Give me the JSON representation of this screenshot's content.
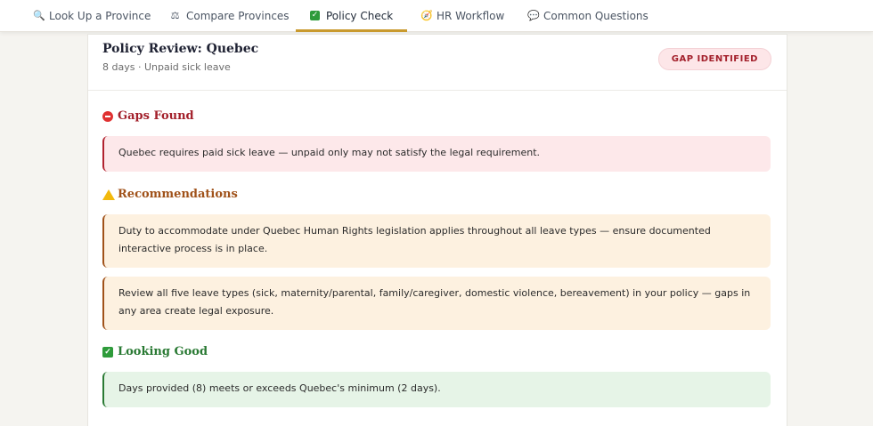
{
  "nav": {
    "tabs": [
      {
        "icon": "search-icon",
        "label": "Look Up a Province"
      },
      {
        "icon": "scales-icon",
        "label": "Compare Provinces"
      },
      {
        "icon": "check-icon",
        "label": "Policy Check",
        "active": true
      },
      {
        "icon": "compass-icon",
        "label": "HR Workflow"
      },
      {
        "icon": "speech-bubble-icon",
        "label": "Common Questions"
      }
    ]
  },
  "review": {
    "title": "Policy Review: Quebec",
    "subtitle": "8 days · Unpaid sick leave",
    "badge": "GAP IDENTIFIED"
  },
  "sections": {
    "gaps": {
      "heading": "Gaps Found",
      "items": [
        "Quebec requires paid sick leave — unpaid only may not satisfy the legal requirement."
      ]
    },
    "recommendations": {
      "heading": "Recommendations",
      "items": [
        "Duty to accommodate under Quebec Human Rights legislation applies throughout all leave types — ensure documented interactive process is in place.",
        "Review all five leave types (sick, maternity/parental, family/caregiver, domestic violence, bereavement) in your policy — gaps in any area create legal exposure."
      ]
    },
    "good": {
      "heading": "Looking Good",
      "items": [
        "Days provided (8) meets or exceeds Quebec's minimum (2 days)."
      ]
    }
  },
  "colors": {
    "accent": "#c99a2e",
    "gap": "#b1222f",
    "recommendation": "#a0521a",
    "good": "#2a7a34"
  }
}
